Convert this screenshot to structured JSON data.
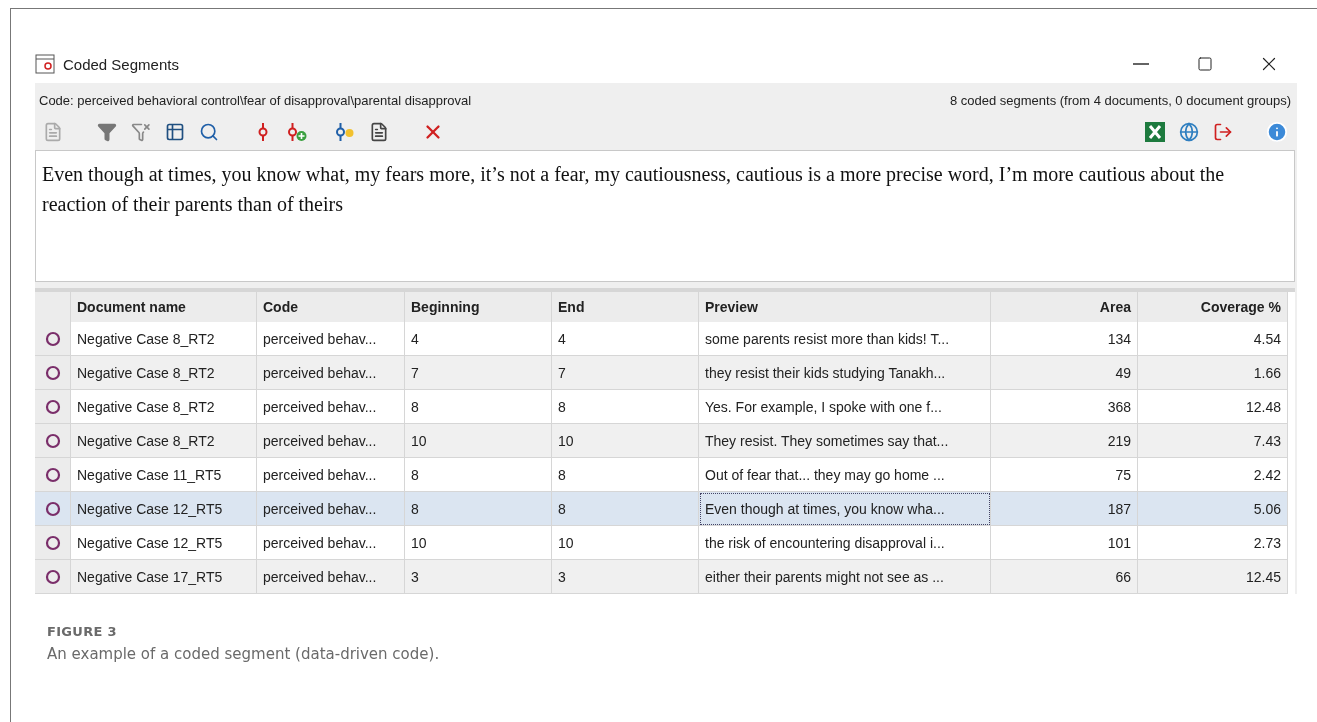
{
  "window": {
    "title": "Coded Segments"
  },
  "info": {
    "code": "Code: perceived behavioral control\\fear of disapproval\\parental disapproval",
    "summary": "8 coded segments (from 4 documents, 0 document groups)"
  },
  "segment_text": "Even though at times, you know what, my fears more, it’s not a fear, my cautiousness, cautious is a more precise word, I’m more cautious about the reaction of their parents than of theirs",
  "table": {
    "columns": [
      {
        "label": "Document name",
        "kind": "text"
      },
      {
        "label": "Code",
        "kind": "text"
      },
      {
        "label": "Beginning",
        "kind": "text"
      },
      {
        "label": "End",
        "kind": "text"
      },
      {
        "label": "Preview",
        "kind": "text"
      },
      {
        "label": "Area",
        "kind": "number"
      },
      {
        "label": "Coverage %",
        "kind": "number"
      }
    ],
    "rows": [
      {
        "selected": false,
        "cells": [
          "Negative Case 8_RT2",
          "perceived behav...",
          "4",
          "4",
          "some parents resist more than kids! T...",
          "134",
          "4.54"
        ]
      },
      {
        "selected": false,
        "cells": [
          "Negative Case 8_RT2",
          "perceived behav...",
          "7",
          "7",
          "they resist their kids studying Tanakh...",
          "49",
          "1.66"
        ]
      },
      {
        "selected": false,
        "cells": [
          "Negative Case 8_RT2",
          "perceived behav...",
          "8",
          "8",
          "Yes. For example, I spoke with one f...",
          "368",
          "12.48"
        ]
      },
      {
        "selected": false,
        "cells": [
          "Negative Case 8_RT2",
          "perceived behav...",
          "10",
          "10",
          "They resist. They sometimes say that...",
          "219",
          "7.43"
        ]
      },
      {
        "selected": false,
        "cells": [
          "Negative Case 11_RT5",
          "perceived behav...",
          "8",
          "8",
          "Out of fear that... they may go home ...",
          "75",
          "2.42"
        ]
      },
      {
        "selected": true,
        "cells": [
          "Negative Case 12_RT5",
          "perceived behav...",
          "8",
          "8",
          "Even though at times, you know wha...",
          "187",
          "5.06"
        ]
      },
      {
        "selected": false,
        "cells": [
          "Negative Case 12_RT5",
          "perceived behav...",
          "10",
          "10",
          "the risk of encountering disapproval i...",
          "101",
          "2.73"
        ]
      },
      {
        "selected": false,
        "cells": [
          "Negative Case 17_RT5",
          "perceived behav...",
          "3",
          "3",
          "either their parents might not see as ...",
          "66",
          "12.45"
        ]
      }
    ]
  },
  "caption": {
    "label": "FIGURE 3",
    "text": "An example of a coded segment (data-driven code)."
  }
}
